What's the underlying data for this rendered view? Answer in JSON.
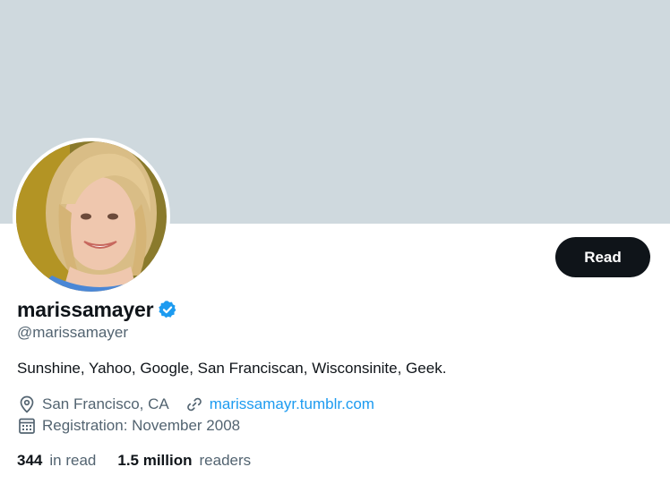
{
  "profile": {
    "display_name": "marissamayer",
    "handle": "@marissamayer",
    "bio": "Sunshine, Yahoo, Google, San Franciscan, Wisconsinite, Geek.",
    "location": "San Francisco, CA",
    "website": "marissamayr.tumblr.com",
    "registration": "Registration: November 2008",
    "verified_color": "#1d9bf0"
  },
  "actions": {
    "read_label": "Read"
  },
  "stats": {
    "in_read_count": "344",
    "in_read_label": "in read",
    "readers_count": "1.5 million",
    "readers_label": "readers"
  },
  "colors": {
    "banner": "#cfd9de",
    "button_bg": "#0f1419",
    "link": "#1d9bf0",
    "secondary_text": "#536471"
  },
  "icons": {
    "verified": "verified-badge-icon",
    "location": "location-pin-icon",
    "link": "link-icon",
    "calendar": "calendar-icon"
  }
}
